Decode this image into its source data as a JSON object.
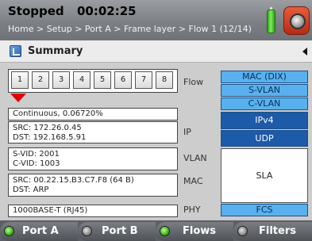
{
  "header": {
    "status": "Stopped",
    "timer": "00:02:25",
    "breadcrumb": "Home > Setup > Port A > Frame layer > Flow 1 (12/14)"
  },
  "section": {
    "title": "Summary"
  },
  "flows": {
    "label": "Flow",
    "numbers": [
      "1",
      "2",
      "3",
      "4",
      "5",
      "6",
      "7",
      "8"
    ],
    "selected": "1"
  },
  "rate": {
    "text": "Continuous, 0.06720%"
  },
  "ip": {
    "label": "IP",
    "src": "SRC: 172.26.0.45",
    "dst": "DST: 192.168.5.91"
  },
  "vlan": {
    "label": "VLAN",
    "svid": "S-VID: 2001",
    "cvid": "C-VID: 1003"
  },
  "mac": {
    "label": "MAC",
    "src": "SRC: 00.22.15.B3.C7.F8 (64 B)",
    "dst": "DST: ARP"
  },
  "phy": {
    "label": "PHY",
    "value": "1000BASE-T (RJ45)"
  },
  "stack": [
    "MAC (DIX)",
    "S-VLAN",
    "C-VLAN",
    "IPv4",
    "UDP",
    "SLA",
    "FCS"
  ],
  "tabs": [
    {
      "label": "Port A",
      "active": true
    },
    {
      "label": "Port B",
      "active": false
    },
    {
      "label": "Flows",
      "active": true
    },
    {
      "label": "Filters",
      "active": false
    }
  ]
}
